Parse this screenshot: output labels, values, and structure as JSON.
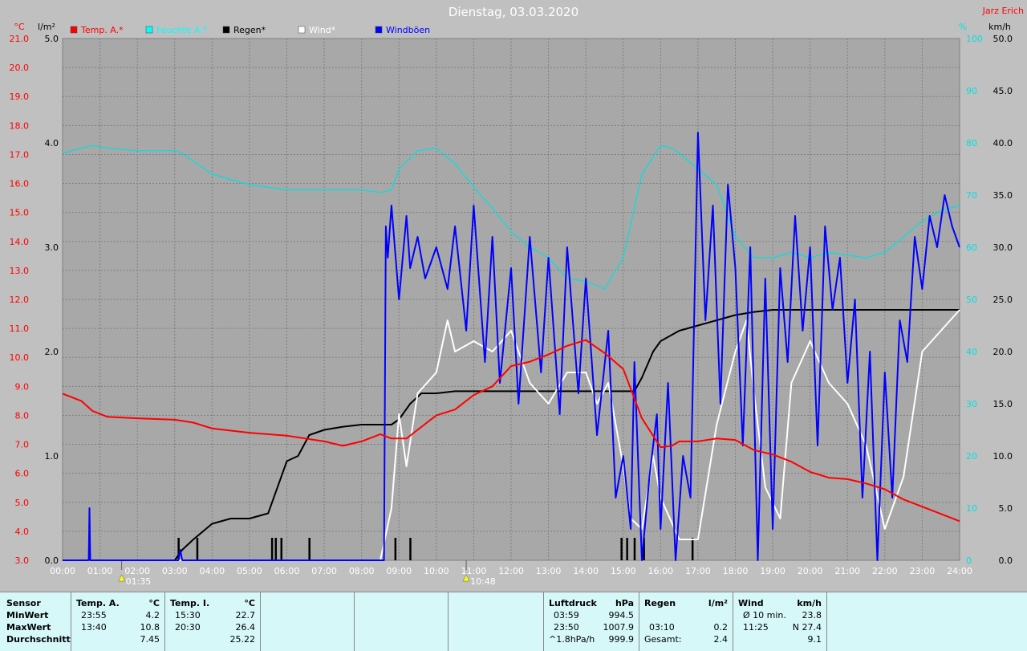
{
  "chart_data": {
    "type": "line",
    "title": "Dienstag, 03.03.2020",
    "author": "Jarz Erich",
    "x_ticks": [
      "00:00",
      "01:00",
      "02:00",
      "03:00",
      "04:00",
      "05:00",
      "06:00",
      "07:00",
      "08:00",
      "09:00",
      "10:00",
      "11:00",
      "12:00",
      "13:00",
      "14:00",
      "15:00",
      "16:00",
      "17:00",
      "18:00",
      "19:00",
      "20:00",
      "21:00",
      "22:00",
      "23:00",
      "24:00"
    ],
    "markers": [
      {
        "label": "01:35",
        "hour": 1.58
      },
      {
        "label": "10:48",
        "hour": 10.8
      }
    ],
    "axes": {
      "temp": {
        "unit": "°C",
        "color": "#ff0000",
        "ylim": [
          3.0,
          21.0
        ],
        "ticks": [
          "3.0",
          "4.0",
          "5.0",
          "6.0",
          "7.0",
          "8.0",
          "9.0",
          "10.0",
          "11.0",
          "12.0",
          "13.0",
          "14.0",
          "15.0",
          "16.0",
          "17.0",
          "18.0",
          "19.0",
          "20.0",
          "21.0"
        ]
      },
      "rain": {
        "unit": "l/m²",
        "color": "#000000",
        "ylim": [
          0.0,
          5.0
        ],
        "ticks": [
          "0.0",
          "1.0",
          "2.0",
          "3.0",
          "4.0",
          "5.0"
        ]
      },
      "humidity": {
        "unit": "%",
        "color": "#00e0e0",
        "ylim": [
          0,
          100
        ],
        "ticks": [
          "0",
          "10",
          "20",
          "30",
          "40",
          "50",
          "60",
          "70",
          "80",
          "90",
          "100"
        ]
      },
      "wind": {
        "unit": "km/h",
        "color": "#000000",
        "ylim": [
          0.0,
          50.0
        ],
        "ticks": [
          "0.0",
          "5.0",
          "10.0",
          "15.0",
          "20.0",
          "25.0",
          "30.0",
          "35.0",
          "40.0",
          "45.0",
          "50.0"
        ]
      }
    },
    "legend": [
      {
        "name": "Temp. A.*",
        "color": "#ff0000"
      },
      {
        "name": "Feuchte A.*",
        "color": "#00ffff"
      },
      {
        "name": "Regen*",
        "color": "#000000"
      },
      {
        "name": "Wind*",
        "color": "#ffffff"
      },
      {
        "name": "Windböen",
        "color": "#0000ff"
      }
    ],
    "series": [
      {
        "name": "Temp. A.*",
        "axis": "temp",
        "color": "#ff0000",
        "x": [
          0,
          0.5,
          0.8,
          1.2,
          2,
          3,
          3.5,
          4,
          5,
          6,
          7,
          7.5,
          8,
          8.5,
          8.8,
          9.2,
          9.5,
          10,
          10.5,
          11,
          11.5,
          12,
          12.5,
          13,
          13.5,
          14,
          14.5,
          15,
          15.5,
          16,
          16.3,
          16.5,
          17,
          17.5,
          18,
          18.5,
          19,
          19.5,
          20,
          20.5,
          21,
          21.5,
          22,
          22.5,
          23,
          23.5,
          24
        ],
        "y": [
          8.75,
          8.5,
          8.15,
          7.95,
          7.9,
          7.85,
          7.75,
          7.55,
          7.4,
          7.3,
          7.1,
          6.95,
          7.1,
          7.35,
          7.2,
          7.2,
          7.5,
          8,
          8.2,
          8.7,
          9.0,
          9.7,
          9.85,
          10.1,
          10.4,
          10.6,
          10.15,
          9.6,
          7.9,
          6.9,
          6.95,
          7.1,
          7.1,
          7.2,
          7.15,
          6.8,
          6.65,
          6.4,
          6.05,
          5.85,
          5.8,
          5.65,
          5.45,
          5.1,
          4.85,
          4.6,
          4.35
        ]
      },
      {
        "name": "Feuchte A.*",
        "axis": "humidity",
        "color": "#00e0e0",
        "x": [
          0,
          0.5,
          0.8,
          1.2,
          2,
          3,
          3.2,
          4,
          5,
          6,
          7,
          8,
          8.5,
          8.8,
          9,
          9.5,
          10,
          10.5,
          11,
          11.5,
          12,
          12.5,
          13,
          13.5,
          14,
          14.5,
          15,
          15.5,
          16,
          16.3,
          16.5,
          17,
          17.5,
          18,
          18.5,
          19,
          19.5,
          20,
          20.5,
          21,
          21.5,
          22,
          22.5,
          23,
          23.5,
          24
        ],
        "y": [
          78,
          79,
          79.5,
          79,
          78.5,
          78.5,
          78,
          74,
          72,
          71,
          71,
          71,
          70.5,
          71,
          75,
          78.5,
          79,
          76,
          71.5,
          67.5,
          63,
          60,
          58,
          54,
          53.5,
          52,
          58,
          74,
          79.5,
          79,
          78,
          75,
          72,
          62,
          58,
          58,
          59,
          58,
          59,
          58.5,
          58,
          59,
          62,
          65,
          67,
          68
        ]
      },
      {
        "name": "Regen*",
        "axis": "rain",
        "color": "#000000",
        "x": [
          0,
          3,
          3.2,
          3.5,
          4,
          4.5,
          5,
          5.5,
          5.8,
          6,
          6.3,
          6.6,
          7,
          7.5,
          8,
          8.5,
          8.8,
          9,
          9.3,
          9.6,
          10,
          10.5,
          11,
          11.5,
          12,
          12.5,
          13,
          13.5,
          14,
          14.5,
          15,
          15.3,
          15.5,
          15.8,
          16,
          16.5,
          17,
          17.5,
          18,
          18.5,
          19,
          20,
          21,
          22,
          23,
          24
        ],
        "y": [
          0,
          0,
          0.1,
          0.2,
          0.35,
          0.4,
          0.4,
          0.45,
          0.75,
          0.95,
          1.0,
          1.2,
          1.25,
          1.28,
          1.3,
          1.3,
          1.3,
          1.35,
          1.5,
          1.6,
          1.6,
          1.62,
          1.62,
          1.62,
          1.62,
          1.62,
          1.62,
          1.62,
          1.62,
          1.62,
          1.62,
          1.62,
          1.75,
          2.0,
          2.1,
          2.2,
          2.25,
          2.3,
          2.35,
          2.38,
          2.4,
          2.4,
          2.4,
          2.4,
          2.4,
          2.4
        ]
      },
      {
        "name": "Wind*",
        "axis": "wind",
        "color": "#ffffff",
        "x": [
          0,
          8.5,
          8.8,
          9,
          9.2,
          9.5,
          10,
          10.3,
          10.5,
          11,
          11.5,
          12,
          12.5,
          13,
          13.5,
          14,
          14.3,
          14.6,
          15,
          15.2,
          15.5,
          15.8,
          16,
          16.5,
          17,
          17.5,
          18,
          18.3,
          18.5,
          18.8,
          19.2,
          19.5,
          20,
          20.5,
          21,
          21.5,
          22,
          22.5,
          23,
          23.5,
          24
        ],
        "y": [
          0,
          0,
          5,
          14,
          9,
          16,
          18,
          23,
          20,
          21,
          20,
          22,
          17,
          15,
          18,
          18,
          15,
          17,
          9,
          4,
          3,
          10,
          6,
          2,
          2,
          13,
          20,
          23,
          16,
          7,
          4,
          17,
          21,
          17,
          15,
          11,
          3,
          8,
          20,
          22,
          24
        ]
      },
      {
        "name": "Windböen",
        "axis": "wind",
        "color": "#0000ff",
        "x": [
          0,
          0.7,
          0.72,
          0.74,
          3.1,
          3.15,
          3.2,
          8.6,
          8.65,
          8.7,
          8.8,
          9,
          9.2,
          9.3,
          9.5,
          9.7,
          10,
          10.3,
          10.5,
          10.8,
          11,
          11.3,
          11.5,
          11.7,
          12,
          12.2,
          12.5,
          12.8,
          13,
          13.3,
          13.5,
          13.8,
          14,
          14.3,
          14.6,
          14.8,
          15,
          15.2,
          15.3,
          15.5,
          15.7,
          15.9,
          16,
          16.2,
          16.4,
          16.6,
          16.8,
          17,
          17.2,
          17.4,
          17.6,
          17.8,
          18,
          18.2,
          18.4,
          18.6,
          18.8,
          19,
          19.2,
          19.4,
          19.6,
          19.8,
          20,
          20.2,
          20.4,
          20.6,
          20.8,
          21,
          21.2,
          21.4,
          21.6,
          21.8,
          22,
          22.2,
          22.4,
          22.6,
          22.8,
          23,
          23.2,
          23.4,
          23.6,
          23.8,
          24
        ],
        "y": [
          0,
          0,
          5,
          0,
          0,
          1,
          0,
          0,
          32,
          29,
          34,
          25,
          33,
          28,
          31,
          27,
          30,
          26,
          32,
          22,
          34,
          19,
          31,
          17,
          28,
          15,
          31,
          18,
          29,
          14,
          30,
          16,
          27,
          12,
          22,
          6,
          10,
          3,
          19,
          0,
          8,
          14,
          3,
          17,
          0,
          10,
          6,
          41,
          23,
          34,
          15,
          36,
          28,
          11,
          30,
          0,
          27,
          3,
          28,
          19,
          33,
          22,
          30,
          11,
          32,
          24,
          29,
          17,
          25,
          6,
          20,
          0,
          18,
          6,
          23,
          19,
          31,
          26,
          33,
          30,
          35,
          32,
          30
        ]
      }
    ],
    "rain_bars_hours": [
      3.1,
      3.6,
      5.6,
      5.7,
      5.85,
      6.6,
      8.9,
      9.3,
      14.95,
      15.1,
      15.3,
      15.55,
      16.85
    ]
  },
  "stats": {
    "sensor": {
      "title": "Sensor",
      "rows": [
        "MinWert",
        "MaxWert",
        "Durchschnitt"
      ]
    },
    "temp_a": {
      "title": "Temp. A.",
      "unit": "°C",
      "rows": [
        [
          "23:55",
          "4.2"
        ],
        [
          "13:40",
          "10.8"
        ],
        [
          "",
          "7.45"
        ]
      ]
    },
    "temp_i": {
      "title": "Temp. I.",
      "unit": "°C",
      "rows": [
        [
          "15:30",
          "22.7"
        ],
        [
          "20:30",
          "26.4"
        ],
        [
          "",
          "25.22"
        ]
      ]
    },
    "pressure": {
      "title": "Luftdruck",
      "unit": "hPa",
      "rows": [
        [
          "03:59",
          "994.5"
        ],
        [
          "23:50",
          "1007.9"
        ],
        [
          "^1.8hPa/h",
          "999.9"
        ]
      ]
    },
    "rain": {
      "title": "Regen",
      "unit": "l/m²",
      "rows": [
        [
          "",
          ""
        ],
        [
          "03:10",
          "0.2"
        ],
        [
          "Gesamt:",
          "2.4"
        ]
      ]
    },
    "wind": {
      "title": "Wind",
      "unit": "km/h",
      "rows": [
        [
          "Ø 10 min.",
          "23.8"
        ],
        [
          "11:25",
          "N 27.4"
        ],
        [
          "",
          "9.1"
        ]
      ]
    }
  }
}
